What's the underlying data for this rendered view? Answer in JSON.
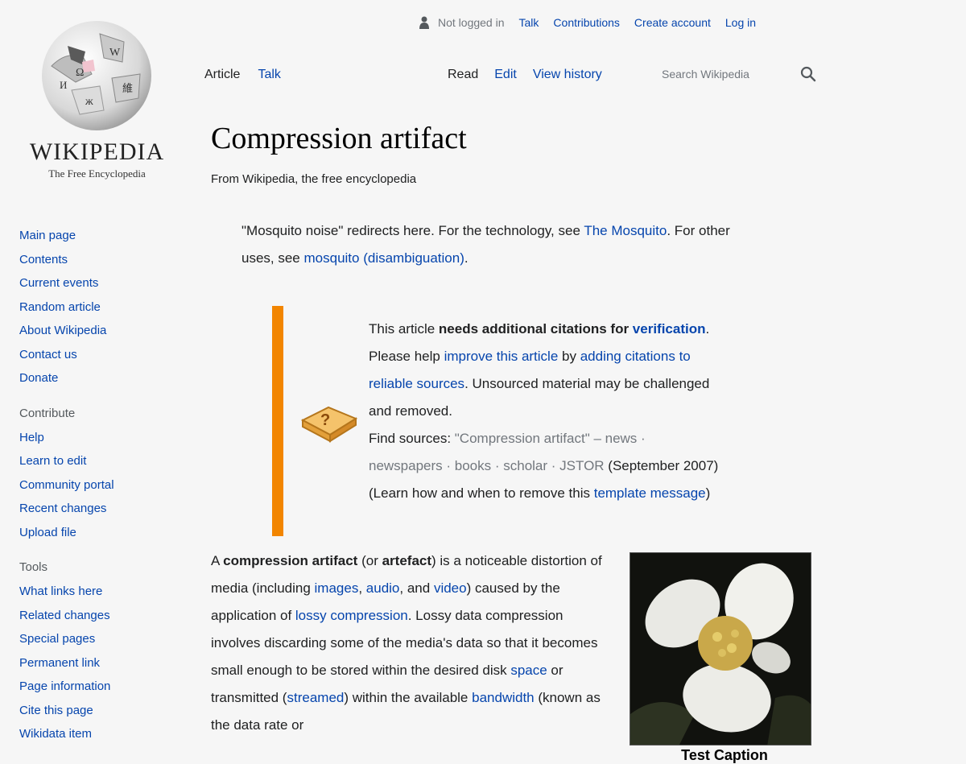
{
  "logo": {
    "wordmark": "WIKIPEDIA",
    "tagline": "The Free Encyclopedia"
  },
  "personal_tools": {
    "not_logged_in": "Not logged in",
    "talk": "Talk",
    "contributions": "Contributions",
    "create_account": "Create account",
    "log_in": "Log in"
  },
  "namespace_tabs": [
    {
      "label": "Article"
    },
    {
      "label": "Talk"
    }
  ],
  "view_tabs": [
    {
      "label": "Read"
    },
    {
      "label": "Edit"
    },
    {
      "label": "View history"
    }
  ],
  "search": {
    "placeholder": "Search Wikipedia"
  },
  "sidebar": {
    "navigation": [
      {
        "label": "Main page"
      },
      {
        "label": "Contents"
      },
      {
        "label": "Current events"
      },
      {
        "label": "Random article"
      },
      {
        "label": "About Wikipedia"
      },
      {
        "label": "Contact us"
      },
      {
        "label": "Donate"
      }
    ],
    "contribute_heading": "Contribute",
    "contribute": [
      {
        "label": "Help"
      },
      {
        "label": "Learn to edit"
      },
      {
        "label": "Community portal"
      },
      {
        "label": "Recent changes"
      },
      {
        "label": "Upload file"
      }
    ],
    "tools_heading": "Tools",
    "tools": [
      {
        "label": "What links here"
      },
      {
        "label": "Related changes"
      },
      {
        "label": "Special pages"
      },
      {
        "label": "Permanent link"
      },
      {
        "label": "Page information"
      },
      {
        "label": "Cite this page"
      },
      {
        "label": "Wikidata item"
      }
    ]
  },
  "article": {
    "title": "Compression artifact",
    "site_sub": "From Wikipedia, the free encyclopedia",
    "hatnote": {
      "part1": "\"Mosquito noise\" redirects here. For the technology, see ",
      "link1": "The Mosquito",
      "part2": ". For other uses, see ",
      "link2": "mosquito (disambiguation)",
      "part3": "."
    },
    "ambox": {
      "t1": "This article ",
      "b1": "needs additional citations for ",
      "bl": "verification",
      "t2": ". Please help ",
      "l1": "improve this article",
      "t3": " by ",
      "l2": "adding citations to reliable sources",
      "t4": ". Unsourced material may be challenged and removed.",
      "find": "Find sources: ",
      "sources": "\"Compression artifact\" – news · newspapers · books · scholar · JSTOR",
      "date": " (September 2007)",
      "learn": " (Learn how and when to remove this ",
      "l3": "template message",
      "end": ")"
    },
    "para": {
      "t1": "A ",
      "b1": "compression artifact",
      "t2": " (or ",
      "b2": "artefact",
      "t3": ") is a noticeable distortion of media (including ",
      "l1": "images",
      "t4": ", ",
      "l2": "audio",
      "t5": ", and ",
      "l3": "video",
      "t6": ") caused by the application of ",
      "l4": "lossy compression",
      "t7": ". Lossy data compression involves discarding some of the media's data so that it becomes small enough to be stored within the desired disk ",
      "l5": "space",
      "t8": " or transmitted (",
      "l6": "streamed",
      "t9": ") within the available ",
      "l7": "bandwidth",
      "t10": " (known as the data rate or"
    },
    "figure": {
      "caption": "Test Caption"
    }
  },
  "colors": {
    "link": "#0645ad",
    "ambox_bar": "#f28500",
    "background": "#f6f6f6"
  }
}
